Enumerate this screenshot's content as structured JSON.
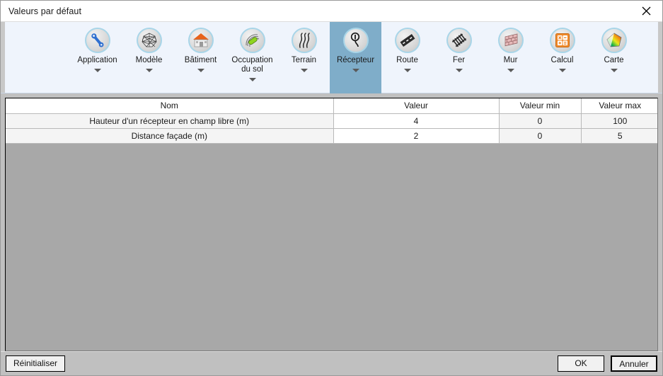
{
  "window": {
    "title": "Valeurs par défaut",
    "close_icon": "close-icon"
  },
  "ribbon": {
    "items": [
      {
        "label": "Application",
        "icon": "wrench-icon",
        "caret": true,
        "selected": false
      },
      {
        "label": "Modèle",
        "icon": "mesh-globe-icon",
        "caret": true,
        "selected": false
      },
      {
        "label": "Bâtiment",
        "icon": "building-icon",
        "caret": true,
        "selected": false
      },
      {
        "label": "Occupation du sol",
        "icon": "landuse-icon",
        "caret": true,
        "selected": false
      },
      {
        "label": "Terrain",
        "icon": "terrain-icon",
        "caret": true,
        "selected": false
      },
      {
        "label": "Récepteur",
        "icon": "receiver-icon",
        "caret": true,
        "selected": true
      },
      {
        "label": "Route",
        "icon": "road-icon",
        "caret": true,
        "selected": false
      },
      {
        "label": "Fer",
        "icon": "railway-icon",
        "caret": true,
        "selected": false
      },
      {
        "label": "Mur",
        "icon": "wall-icon",
        "caret": true,
        "selected": false
      },
      {
        "label": "Calcul",
        "icon": "calculator-icon",
        "caret": true,
        "selected": false
      },
      {
        "label": "Carte",
        "icon": "colormap-icon",
        "caret": true,
        "selected": false
      }
    ]
  },
  "table": {
    "columns": [
      "Nom",
      "Valeur",
      "Valeur min",
      "Valeur max"
    ],
    "rows": [
      {
        "nom": "Hauteur d'un récepteur en champ libre (m)",
        "valeur": "4",
        "min": "0",
        "max": "100"
      },
      {
        "nom": "Distance façade (m)",
        "valeur": "2",
        "min": "0",
        "max": "5"
      }
    ]
  },
  "footer": {
    "reset_label": "Réinitialiser",
    "ok_label": "OK",
    "cancel_label": "Annuler"
  },
  "colors": {
    "selected_tab": "#7fadc9",
    "ribbon_bg": "#eff4fc",
    "name_text_green": "#0a8a0a",
    "dialog_bg": "#c0c0c0",
    "grid_empty": "#a8a8a8"
  }
}
